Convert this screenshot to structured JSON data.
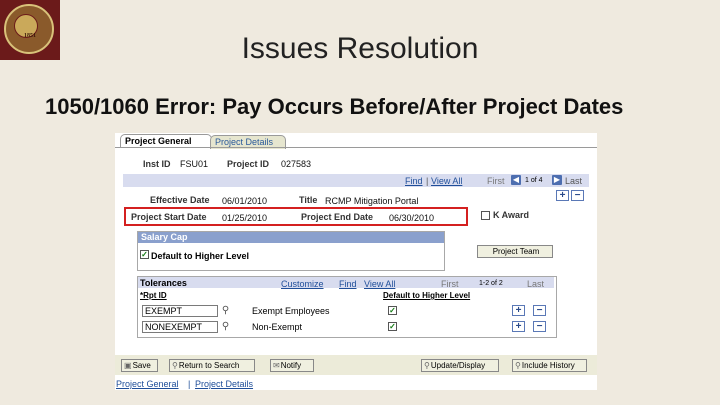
{
  "slide": {
    "title": "Issues Resolution",
    "subtitle": "1050/1060 Error: Pay Occurs Before/After Project Dates",
    "seal_year": "1851"
  },
  "tabs": [
    {
      "label": "Project General",
      "active": true
    },
    {
      "label": "Project Details",
      "active": false
    }
  ],
  "header": {
    "inst_id_label": "Inst ID",
    "inst_id_value": "FSU01",
    "project_id_label": "Project ID",
    "project_id_value": "027583"
  },
  "grid_nav": {
    "find": "Find",
    "view_all": "View All",
    "first": "First",
    "page": "1 of 4",
    "last": "Last"
  },
  "form": {
    "effective_date_label": "Effective Date",
    "effective_date_value": "06/01/2010",
    "title_label": "Title",
    "title_value": "RCMP Mitigation Portal",
    "start_date_label": "Project Start Date",
    "start_date_value": "01/25/2010",
    "end_date_label": "Project End Date",
    "end_date_value": "06/30/2010",
    "k_award_label": "K Award"
  },
  "salary_cap": {
    "title": "Salary Cap",
    "default_label": "Default to Higher Level",
    "default_checked": true
  },
  "project_team_button": "Project Team",
  "tolerances": {
    "title": "Tolerances",
    "customize": "Customize",
    "find": "Find",
    "view_all": "View All",
    "first": "First",
    "page": "1-2 of 2",
    "last": "Last",
    "col_rpt_id": "*Rpt ID",
    "col_default": "Default to Higher Level",
    "rows": [
      {
        "rpt_id": "EXEMPT",
        "description": "Exempt Employees",
        "checked": true
      },
      {
        "rpt_id": "NONEXEMPT",
        "description": "Non-Exempt",
        "checked": true
      }
    ]
  },
  "toolbar": {
    "save": "Save",
    "return_to_search": "Return to Search",
    "notify": "Notify",
    "update_display": "Update/Display",
    "include_history": "Include History"
  },
  "footer_links": {
    "project_general": "Project General",
    "project_details": "Project Details"
  },
  "colors": {
    "highlight": "#d42020",
    "bar": "#d8dcef",
    "link": "#1f4e99"
  }
}
